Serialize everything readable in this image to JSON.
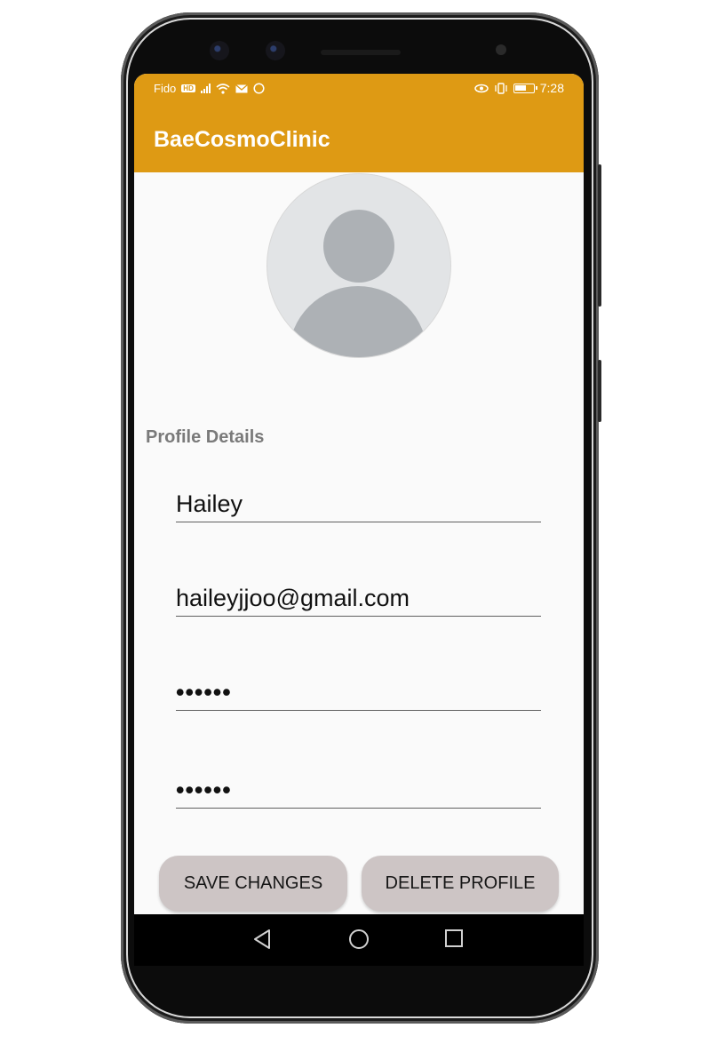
{
  "status_bar": {
    "carrier": "Fido",
    "carrier_badge": "HD",
    "time": "7:28",
    "icons_left": [
      "signal-icon",
      "wifi-icon",
      "mail-icon",
      "circle-icon"
    ],
    "icons_right": [
      "eye-icon",
      "vibrate-icon",
      "battery-icon"
    ]
  },
  "app_bar": {
    "title": "BaeCosmoClinic",
    "color": "#de9a14"
  },
  "profile": {
    "avatar_icon": "default-avatar-icon",
    "section_label": "Profile Details",
    "fields": {
      "name": "Hailey",
      "email": "haileyjjoo@gmail.com",
      "password": "••••••",
      "confirm_password": "••••••"
    }
  },
  "buttons": {
    "save": "SAVE CHANGES",
    "delete": "DELETE PROFILE",
    "color": "#cdc5c5"
  },
  "nav_bar": {
    "icons": [
      "back-icon",
      "home-icon",
      "recents-icon"
    ]
  }
}
